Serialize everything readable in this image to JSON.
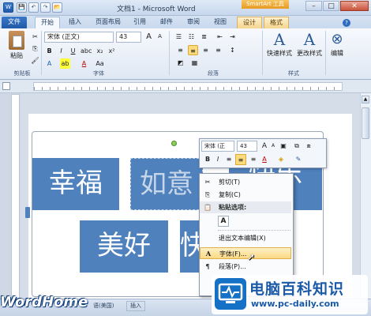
{
  "window": {
    "title": "文档1 - Microsoft Word",
    "context_band": "SmartArt 工具",
    "quick_access": [
      "W",
      "💾",
      "↶",
      "↷",
      "📂"
    ],
    "controls": {
      "minimize": "–",
      "maximize": "□",
      "close": "✕"
    }
  },
  "tabs": {
    "file": "文件",
    "home": "开始",
    "insert": "插入",
    "layout": "页面布局",
    "references": "引用",
    "mailings": "邮件",
    "review": "审阅",
    "view": "视图",
    "design": "设计",
    "format": "格式"
  },
  "ribbon": {
    "paste": "粘贴",
    "font_name": "宋体 (正文)",
    "font_size": "43",
    "grow_font": "A",
    "shrink_font": "A",
    "bold": "B",
    "italic": "I",
    "underline": "U",
    "quick_styles": "快速样式",
    "change_styles": "更改样式",
    "edit": "编辑",
    "groups": {
      "clipboard": "剪贴板",
      "font": "字体",
      "paragraph": "段落",
      "styles": "样式"
    }
  },
  "document": {
    "boxes": [
      "幸福",
      "如意",
      "快乐",
      "美好",
      "快"
    ]
  },
  "mini_toolbar": {
    "font": "宋体 (正",
    "size": "43",
    "bold": "B",
    "italic": "I",
    "font_color": "A"
  },
  "context_menu": {
    "cut": "剪切(T)",
    "copy": "复制(C)",
    "paste_options": "粘贴选项:",
    "paste_keep_text": "A",
    "exit_edit": "退出文本编辑(X)",
    "font": "字体(F)...",
    "paragraph": "段落(P)..."
  },
  "status_bar": {
    "language": "语(美国)",
    "mode": "插入"
  },
  "watermarks": {
    "left": "WordHome",
    "right_title": "电脑百科知识",
    "right_url": "www.pc-daily.com"
  }
}
